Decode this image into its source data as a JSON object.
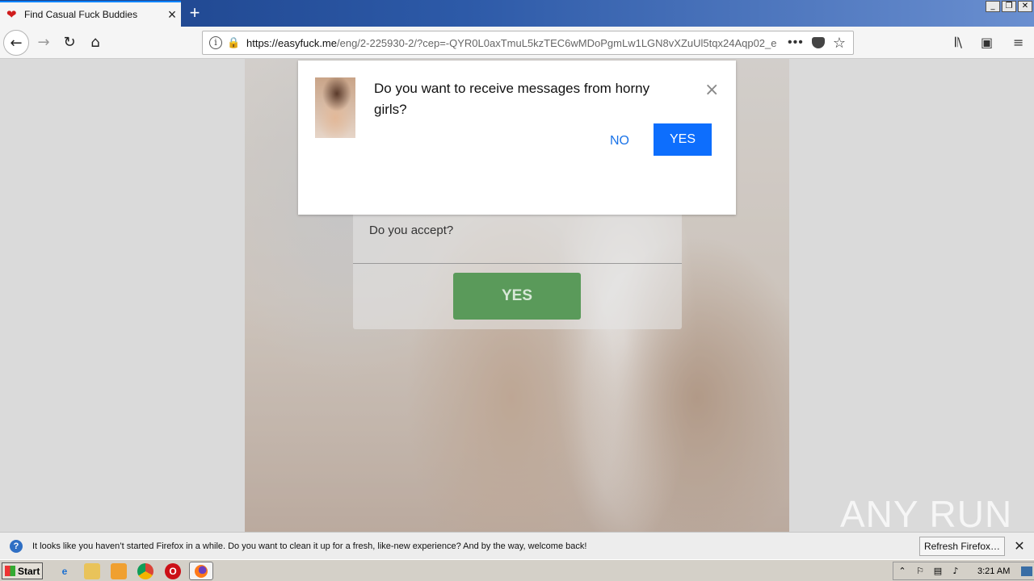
{
  "browser": {
    "tab_title": "Find Casual Fuck Buddies",
    "url_host": "https://easyfuck.me",
    "url_path": "/eng/2-225930-2/?cep=-QYR0L0axTmuL5kzTEC6wMDoPgmLw1LGN8vXZuUl5tqx24Aqp02_e",
    "new_tab": "+",
    "menu": "≡"
  },
  "dialog": {
    "message": "Do you want to receive messages from horny girls?",
    "no_label": "NO",
    "yes_label": "YES",
    "close": "×"
  },
  "consent": {
    "question": "Do you accept?",
    "yes_label": "YES"
  },
  "watermark": "ANY RUN",
  "notification_bar": {
    "text": "It looks like you haven’t started Firefox in a while. Do you want to clean it up for a fresh, like-new experience? And by the way, welcome back!",
    "refresh_label": "Refresh Firefox…",
    "close": "✕"
  },
  "taskbar": {
    "start_label": "Start",
    "clock": "3:21 AM"
  },
  "colors": {
    "accent_blue": "#0d6efd",
    "link_blue": "#1a73e8",
    "consent_green": "#5a9a5a",
    "lock_green": "#12bc00"
  },
  "icons": [
    "heart-icon",
    "close-icon",
    "plus-icon",
    "back-icon",
    "forward-icon",
    "reload-icon",
    "home-icon",
    "info-icon",
    "lock-icon",
    "more-icon",
    "pocket-icon",
    "star-icon",
    "library-icon",
    "sidebar-icon",
    "menu-icon",
    "help-icon",
    "start-flag-icon",
    "ie-icon",
    "folder-icon",
    "media-icon",
    "chrome-icon",
    "opera-icon",
    "firefox-icon"
  ]
}
